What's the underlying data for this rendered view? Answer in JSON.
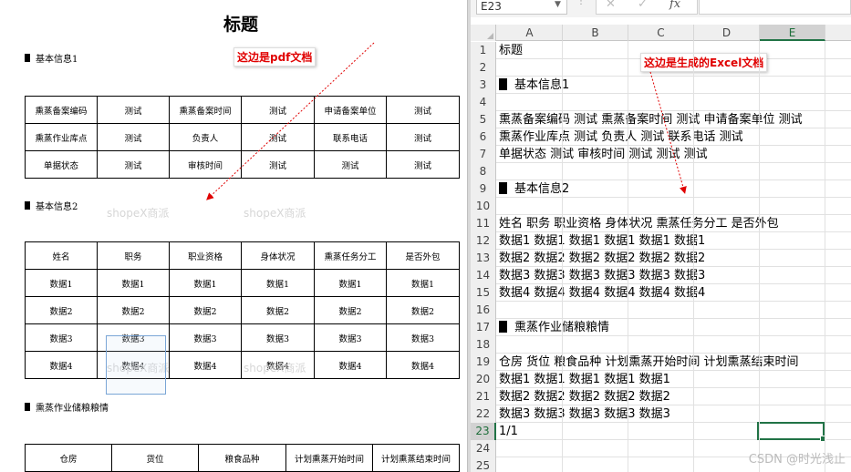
{
  "pdf": {
    "title": "标题",
    "section1": "基本信息1",
    "section2": "基本信息2",
    "section3": "熏蒸作业储粮粮情",
    "table1": [
      [
        "熏蒸备案编码",
        "测试",
        "熏蒸备案时间",
        "测试",
        "申请备案单位",
        "测试"
      ],
      [
        "熏蒸作业库点",
        "测试",
        "负责人",
        "测试",
        "联系电话",
        "测试"
      ],
      [
        "单据状态",
        "测试",
        "审核时间",
        "测试",
        "测试",
        "测试"
      ]
    ],
    "table2_header": [
      "姓名",
      "职务",
      "职业资格",
      "身体状况",
      "熏蒸任务分工",
      "是否外包"
    ],
    "table2_rows": [
      [
        "数据1",
        "数据1",
        "数据1",
        "数据1",
        "数据1",
        "数据1"
      ],
      [
        "数据2",
        "数据2",
        "数据2",
        "数据2",
        "数据2",
        "数据2"
      ],
      [
        "数据3",
        "数据3",
        "数据3",
        "数据3",
        "数据3",
        "数据3"
      ],
      [
        "数据4",
        "数据4",
        "数据4",
        "数据4",
        "数据4",
        "数据4"
      ]
    ],
    "table3_header": [
      "仓房",
      "货位",
      "粮食品种",
      "计划熏蒸开始时间",
      "计划熏蒸结束时间"
    ],
    "annotation": "这边是pdf文档",
    "watermark": "shopeX商派"
  },
  "excel": {
    "name_box": "E23",
    "formula_icons": [
      "cancel-icon",
      "enter-icon",
      "fx-icon"
    ],
    "fx_label": "fx",
    "columns": [
      "A",
      "B",
      "C",
      "D",
      "E"
    ],
    "active_column": "E",
    "active_row": "23",
    "rows": [
      {
        "num": "1",
        "text": "标题"
      },
      {
        "num": "2",
        "text": ""
      },
      {
        "num": "3",
        "text": "基本信息1",
        "block": true
      },
      {
        "num": "4",
        "text": ""
      },
      {
        "num": "5",
        "text": "熏蒸备案编码 测试 熏蒸备案时间 测试 申请备案单位 测试"
      },
      {
        "num": "6",
        "text": "熏蒸作业库点 测试 负责人 测试 联系电话 测试"
      },
      {
        "num": "7",
        "text": "单据状态 测试 审核时间 测试 测试 测试"
      },
      {
        "num": "8",
        "text": ""
      },
      {
        "num": "9",
        "text": "基本信息2",
        "block": true
      },
      {
        "num": "10",
        "text": ""
      },
      {
        "num": "11",
        "text": "姓名 职务 职业资格 身体状况 熏蒸任务分工 是否外包"
      },
      {
        "num": "12",
        "text": "数据1 数据1 数据1 数据1 数据1 数据1"
      },
      {
        "num": "13",
        "text": "数据2 数据2 数据2 数据2 数据2 数据2"
      },
      {
        "num": "14",
        "text": "数据3 数据3 数据3 数据3 数据3 数据3"
      },
      {
        "num": "15",
        "text": "数据4 数据4 数据4 数据4 数据4 数据4"
      },
      {
        "num": "16",
        "text": ""
      },
      {
        "num": "17",
        "text": "熏蒸作业储粮粮情",
        "block": true
      },
      {
        "num": "18",
        "text": ""
      },
      {
        "num": "19",
        "text": "仓房 货位 粮食品种 计划熏蒸开始时间 计划熏蒸结束时间"
      },
      {
        "num": "20",
        "text": "数据1 数据1 数据1 数据1 数据1"
      },
      {
        "num": "21",
        "text": "数据2 数据2 数据2 数据2 数据2"
      },
      {
        "num": "22",
        "text": "数据3 数据3 数据3 数据3 数据3"
      },
      {
        "num": "23",
        "text": "1/1"
      },
      {
        "num": "24",
        "text": ""
      },
      {
        "num": "25",
        "text": ""
      }
    ],
    "annotation": "这边是生成的Excel文档"
  },
  "watermark_csdn": "CSDN @时光浅止",
  "colors": {
    "annotation_red": "#e00000",
    "excel_green": "#217346"
  }
}
